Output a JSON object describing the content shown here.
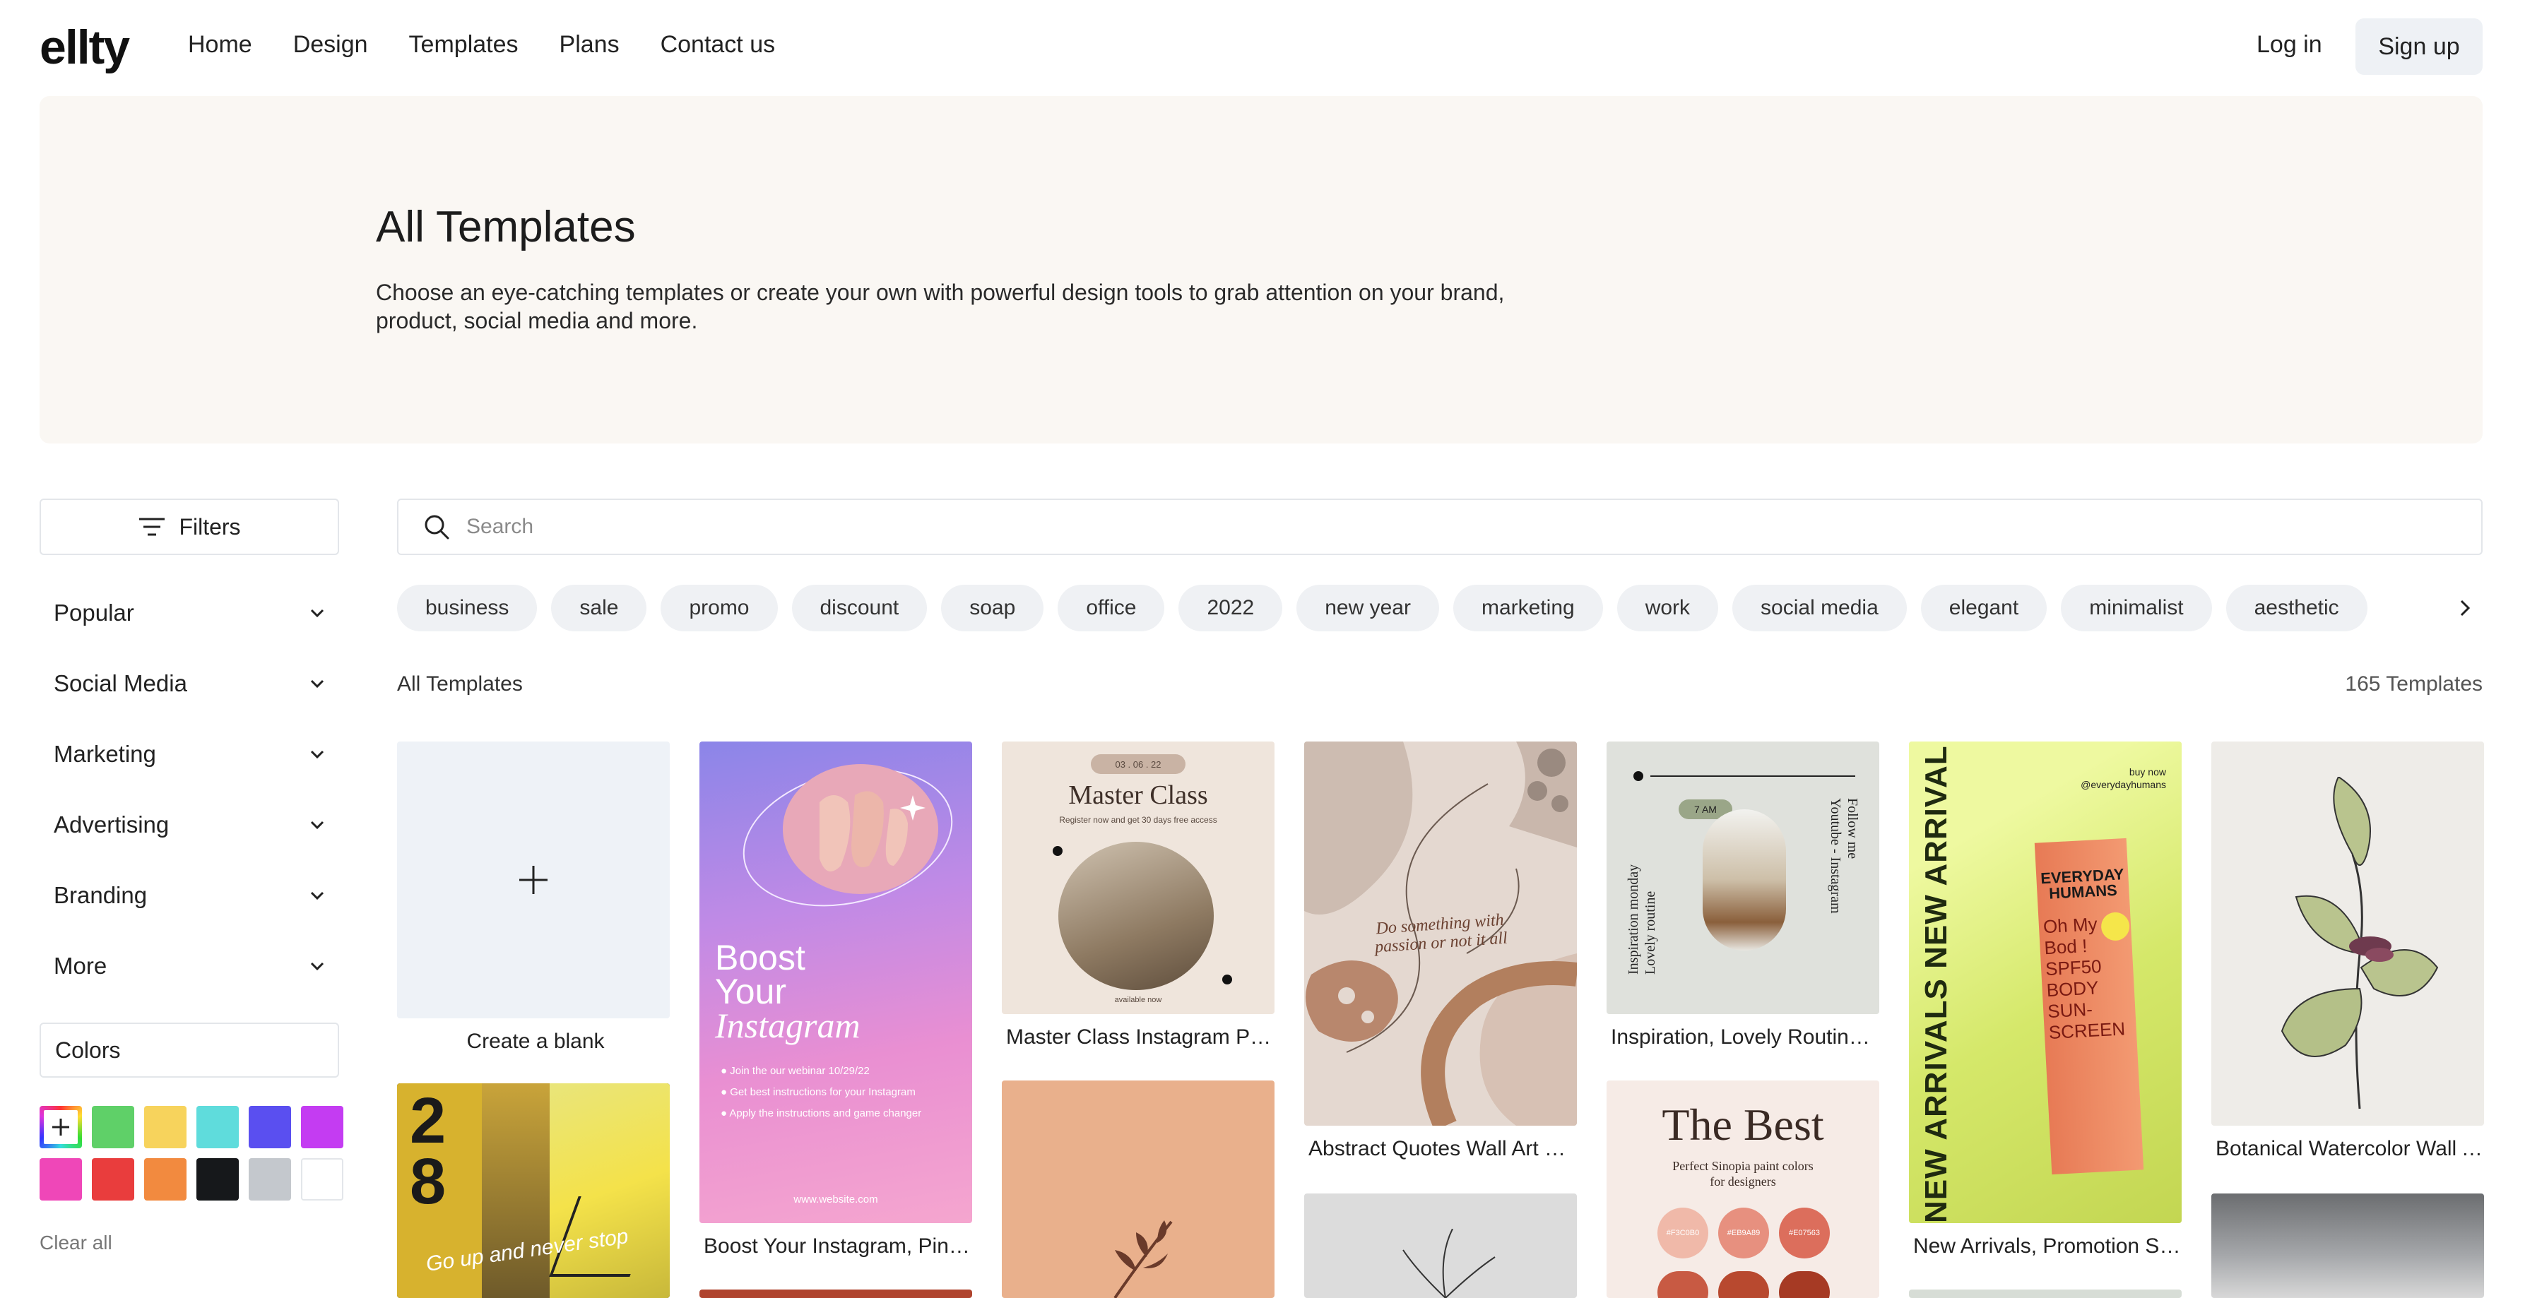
{
  "brand": {
    "logo": "ellty"
  },
  "nav": {
    "items": [
      "Home",
      "Design",
      "Templates",
      "Plans",
      "Contact us"
    ]
  },
  "auth": {
    "login": "Log in",
    "signup": "Sign up"
  },
  "hero": {
    "title": "All Templates",
    "description": "Choose an eye-catching templates or create your own with powerful design tools to grab attention on your brand, product, social media and more."
  },
  "sidebar": {
    "filters_label": "Filters",
    "categories": [
      "Popular",
      "Social Media",
      "Marketing",
      "Advertising",
      "Branding",
      "More"
    ],
    "colors_label": "Colors",
    "swatches": [
      "#ffffff",
      "#5fd068",
      "#f7d35c",
      "#5fdcdc",
      "#5a4ff0",
      "#c43cf2",
      "#ef47b8",
      "#e93d3d",
      "#f28a3f",
      "#16181b",
      "#c4c8cd",
      "#ffffff"
    ],
    "clear_all": "Clear all"
  },
  "search": {
    "placeholder": "Search"
  },
  "tags": [
    "business",
    "sale",
    "promo",
    "discount",
    "soap",
    "office",
    "2022",
    "new year",
    "marketing",
    "work",
    "social media",
    "elegant",
    "minimalist",
    "aesthetic"
  ],
  "section": {
    "title": "All Templates",
    "count": "165 Templates"
  },
  "cards": {
    "blank": "Create a blank",
    "boost": {
      "caption": "Boost Your Instagram, Pinterest Story",
      "line1": "Boost",
      "line2": "Your",
      "line3": "Instagram",
      "b1": "Join the our webinar 10/29/22",
      "b2": "Get best instructions for your Instagram",
      "b3": "Apply the instructions and game changer",
      "site": "www.website.com"
    },
    "master": {
      "caption": "Master Class Instagram Post",
      "title": "Master Class",
      "date": "03 . 06 . 22",
      "sub": "Register now and get 30 days free access",
      "avail": "available now"
    },
    "abstract": {
      "caption": "Abstract Quotes Wall Art Poster",
      "quote1": "Do something with",
      "quote2": "passion or not it all"
    },
    "inspiration": {
      "caption": "Inspiration, Lovely Routine Story",
      "time": "7 AM",
      "left1": "Inspiration monday",
      "left2": "Lovely routine",
      "right1": "Follow me",
      "right2": "Youtube - Instagram"
    },
    "arrivals": {
      "caption": "New Arrivals, Promotion Story",
      "vertical": "NEW ARRIVALS NEW ARRIVAL",
      "buy": "buy now",
      "handle": "@everydayhumans",
      "brand1": "EVERYDAY",
      "brand2": "HUMANS",
      "p1": "Oh My",
      "p2": "Bod !",
      "p3": "SPF50",
      "p4": "BODY",
      "p5": "SUN-",
      "p6": "SCREEN"
    },
    "botanical": {
      "caption": "Botanical Watercolor Wall Art"
    },
    "best": {
      "title": "The Best",
      "sub1": "Perfect Sinopia paint colors",
      "sub2": "for designers",
      "chips": [
        "#F3C0B0",
        "#EB9A89",
        "#E07563"
      ]
    },
    "yellow": {
      "text": "Go up and never stop"
    }
  }
}
